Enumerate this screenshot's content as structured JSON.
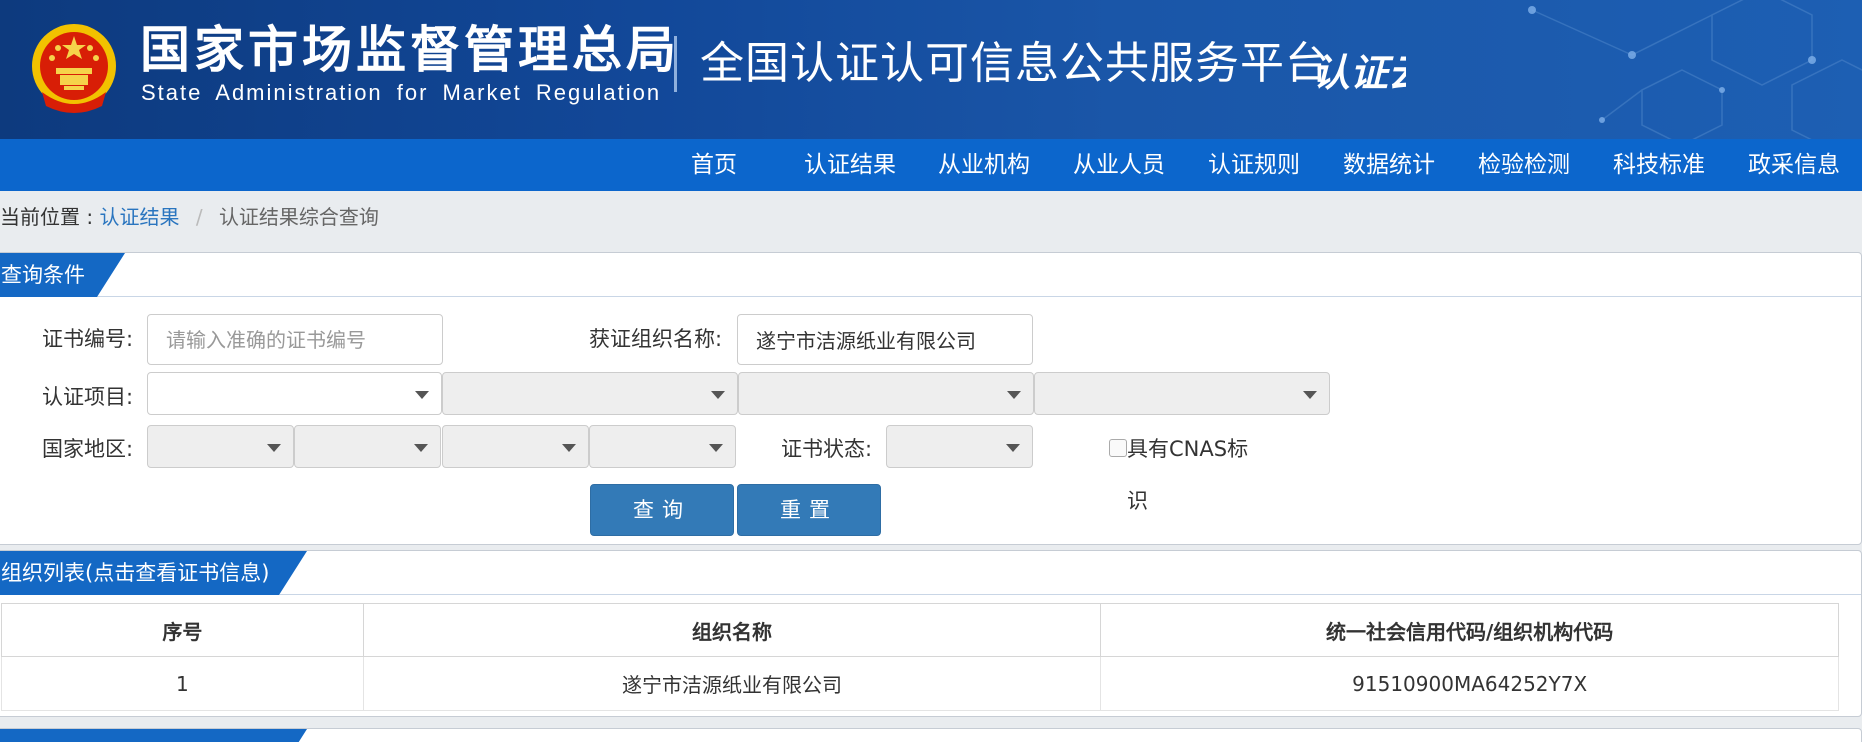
{
  "header": {
    "agency_name_cn": "国家市场监督管理总局",
    "agency_name_en": "State Administration for Market Regulation",
    "platform_title": "全国认证认可信息公共服务平台",
    "brand_logo_text": "认证云",
    "colors": {
      "header_bg": "#124899",
      "nav_bg": "#0c66cc"
    }
  },
  "nav": {
    "items": [
      "首页",
      "认证结果",
      "从业机构",
      "从业人员",
      "认证规则",
      "数据统计",
      "检验检测",
      "科技标准",
      "政采信息"
    ]
  },
  "breadcrumb": {
    "prefix": "当前位置 :",
    "link": "认证结果",
    "separator": "/",
    "current": "认证结果综合查询"
  },
  "query": {
    "title": "查询条件",
    "cert_no_label": "证书编号:",
    "cert_no_placeholder": "请输入准确的证书编号",
    "cert_no_value": "",
    "org_name_label": "获证组织名称:",
    "org_name_value": "遂宁市洁源纸业有限公司",
    "cert_project_label": "认证项目:",
    "country_label": "国家地区:",
    "cert_status_label": "证书状态:",
    "cnas_label": "具有CNAS标识",
    "cnas_checked": false,
    "search_button": "查询",
    "reset_button": "重置"
  },
  "results": {
    "title": "组织列表(点击查看证书信息)",
    "columns": [
      "序号",
      "组织名称",
      "统一社会信用代码/组织机构代码"
    ],
    "rows": [
      {
        "index": "1",
        "org_name": "遂宁市洁源纸业有限公司",
        "credit_code": "91510900MA64252Y7X"
      }
    ]
  }
}
